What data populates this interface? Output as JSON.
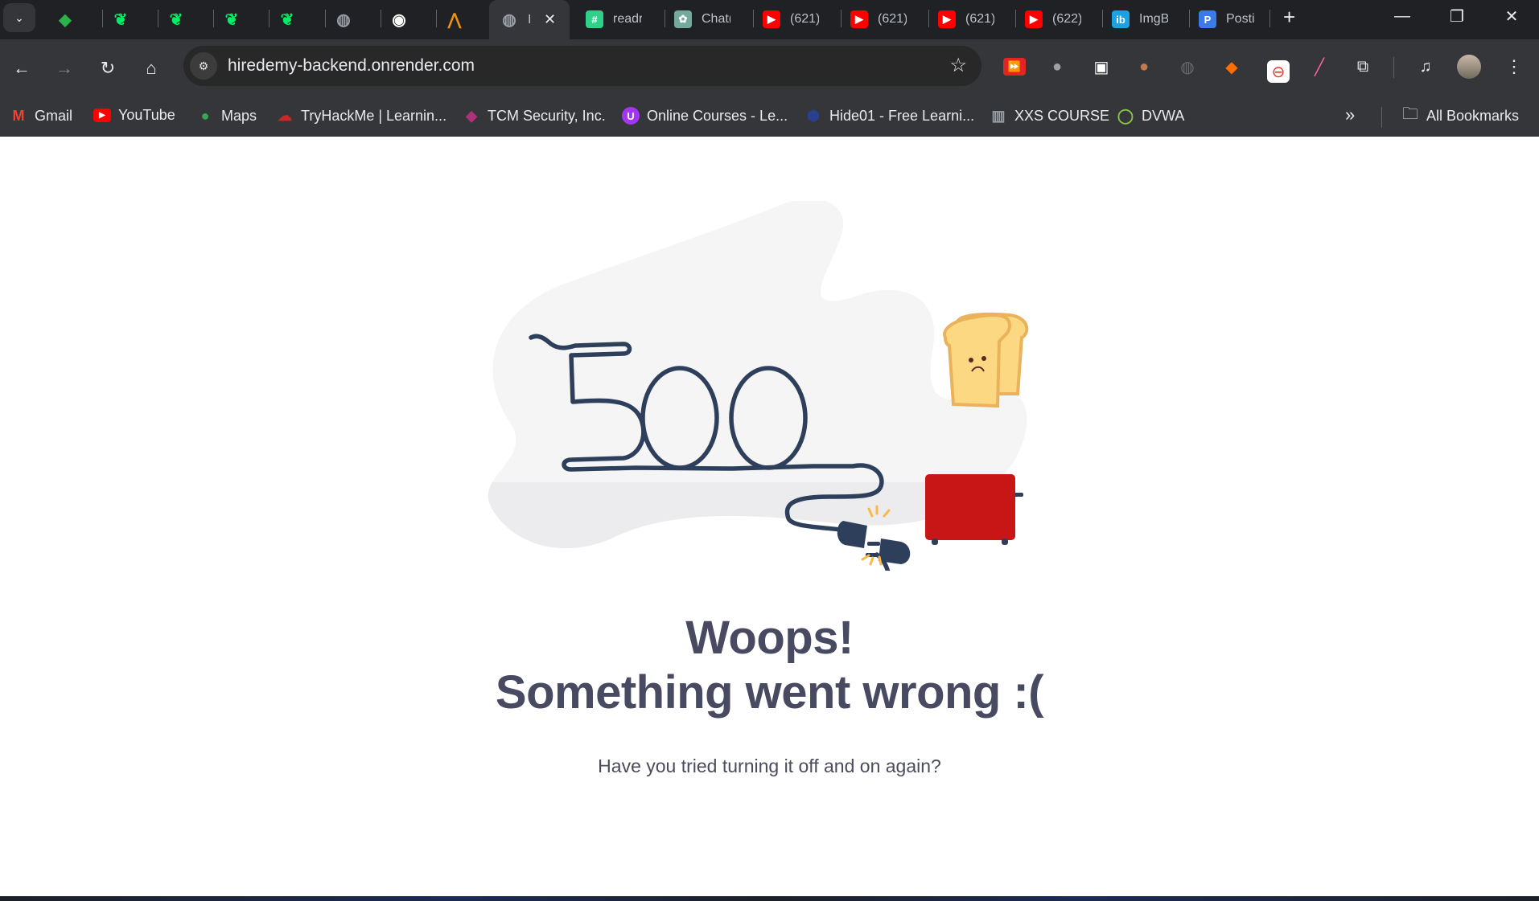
{
  "browser": {
    "tabs": [
      {
        "title": "",
        "icon": "feedly-icon",
        "color": "#2bb24c"
      },
      {
        "title": "",
        "icon": "mongodb-leaf-icon",
        "color": "#00ed64"
      },
      {
        "title": "",
        "icon": "mongodb-leaf-icon",
        "color": "#00ed64"
      },
      {
        "title": "",
        "icon": "mongodb-leaf-icon",
        "color": "#00ed64"
      },
      {
        "title": "",
        "icon": "mongodb-leaf-icon",
        "color": "#00ed64"
      },
      {
        "title": "",
        "icon": "globe-icon",
        "color": "#9aa0a6"
      },
      {
        "title": "",
        "icon": "generic-site-icon",
        "color": "#ffffff"
      },
      {
        "title": "",
        "icon": "phpmyadmin-icon",
        "color": "#f29111"
      },
      {
        "title": "I",
        "icon": "globe-icon",
        "color": "#9aa0a6",
        "active": true
      },
      {
        "title": "readr",
        "icon": "hash-icon",
        "color": "#2fd08a"
      },
      {
        "title": "Chat(",
        "icon": "chatgpt-icon",
        "color": "#74aa9c"
      },
      {
        "title": "(621)",
        "icon": "youtube-icon",
        "color": "#ff0000"
      },
      {
        "title": "(621)",
        "icon": "youtube-icon",
        "color": "#ff0000"
      },
      {
        "title": "(621)",
        "icon": "youtube-icon",
        "color": "#ff0000"
      },
      {
        "title": "(622)",
        "icon": "youtube-icon",
        "color": "#ff0000"
      },
      {
        "title": "ImgB",
        "icon": "imgbb-icon",
        "color": "#1da1e2"
      },
      {
        "title": "Posti",
        "icon": "postimages-icon",
        "color": "#3a7be8"
      }
    ],
    "tab_glyphs": {
      "search_tabs": "⌄",
      "close": "✕",
      "new_tab": "+",
      "minimize": "—",
      "restore": "❐",
      "window_close": "✕"
    },
    "toolbar": {
      "back": "←",
      "forward": "→",
      "reload": "↻",
      "home": "⌂",
      "url": "hiredemy-backend.onrender.com",
      "site_info_glyph": "⚙",
      "bookmark_star": "☆",
      "extensions": [
        {
          "name": "video-speed-icon",
          "glyph": "⏩",
          "color": "#e32424"
        },
        {
          "name": "bug-icon",
          "glyph": "●",
          "color": "#9aa0a6"
        },
        {
          "name": "picture-in-picture-icon",
          "glyph": "▣",
          "color": "#ffffff"
        },
        {
          "name": "cookie-icon",
          "glyph": "●",
          "color": "#c07a4d"
        },
        {
          "name": "idea-extension-icon",
          "glyph": "◍",
          "color": "#6b6b6b"
        },
        {
          "name": "megaphone-icon",
          "glyph": "◆",
          "color": "#ff6d00"
        },
        {
          "name": "adblock-icon",
          "glyph": "⊖",
          "color": "#e53935"
        },
        {
          "name": "color-picker-icon",
          "glyph": "╱",
          "color": "#ff5fa2"
        },
        {
          "name": "extensions-puzzle-icon",
          "glyph": "⧉",
          "color": "#e8eaed"
        }
      ],
      "media_glyph": "♫",
      "menu_glyph": "⋮"
    },
    "bookmarks": [
      {
        "label": "Gmail",
        "icon": "gmail-icon",
        "glyph": "M",
        "color": "#ea4335"
      },
      {
        "label": "YouTube",
        "icon": "youtube-icon",
        "glyph": "▶",
        "color": "#ff0000"
      },
      {
        "label": "Maps",
        "icon": "maps-pin-icon",
        "glyph": "●",
        "color": "#34a853"
      },
      {
        "label": "TryHackMe | Learnin...",
        "icon": "tryhackme-icon",
        "glyph": "☁",
        "color": "#c62828"
      },
      {
        "label": "TCM Security, Inc.",
        "icon": "tcm-security-icon",
        "glyph": "◆",
        "color": "#b0307a"
      },
      {
        "label": "Online Courses - Le...",
        "icon": "udemy-icon",
        "glyph": "U",
        "color": "#a435f0"
      },
      {
        "label": "Hide01 - Free Learni...",
        "icon": "hide01-icon",
        "glyph": "⬢",
        "color": "#2b3f8f"
      },
      {
        "label": "XXS COURSE",
        "icon": "storefront-icon",
        "glyph": "▥",
        "color": "#9aa0a6"
      },
      {
        "label": "DVWA",
        "icon": "dvwa-icon",
        "glyph": "◯",
        "color": "#8bc34a"
      }
    ],
    "bookmarks_overflow_glyph": "»",
    "all_bookmarks_label": "All Bookmarks",
    "folder_glyph": "🗀"
  },
  "page": {
    "error_code": "500",
    "headline_line1": "Woops!",
    "headline_line2": "Something went wrong :(",
    "subline": "Have you tried turning it off and on again?",
    "colors": {
      "cord": "#2e3f5c",
      "toaster": "#c81515",
      "toast": "#fdd882",
      "toast_crust": "#ebb25c",
      "spark": "#fbb84a",
      "blob": "#f5f5f5",
      "floor": "#ececef",
      "text": "#474a60"
    }
  }
}
